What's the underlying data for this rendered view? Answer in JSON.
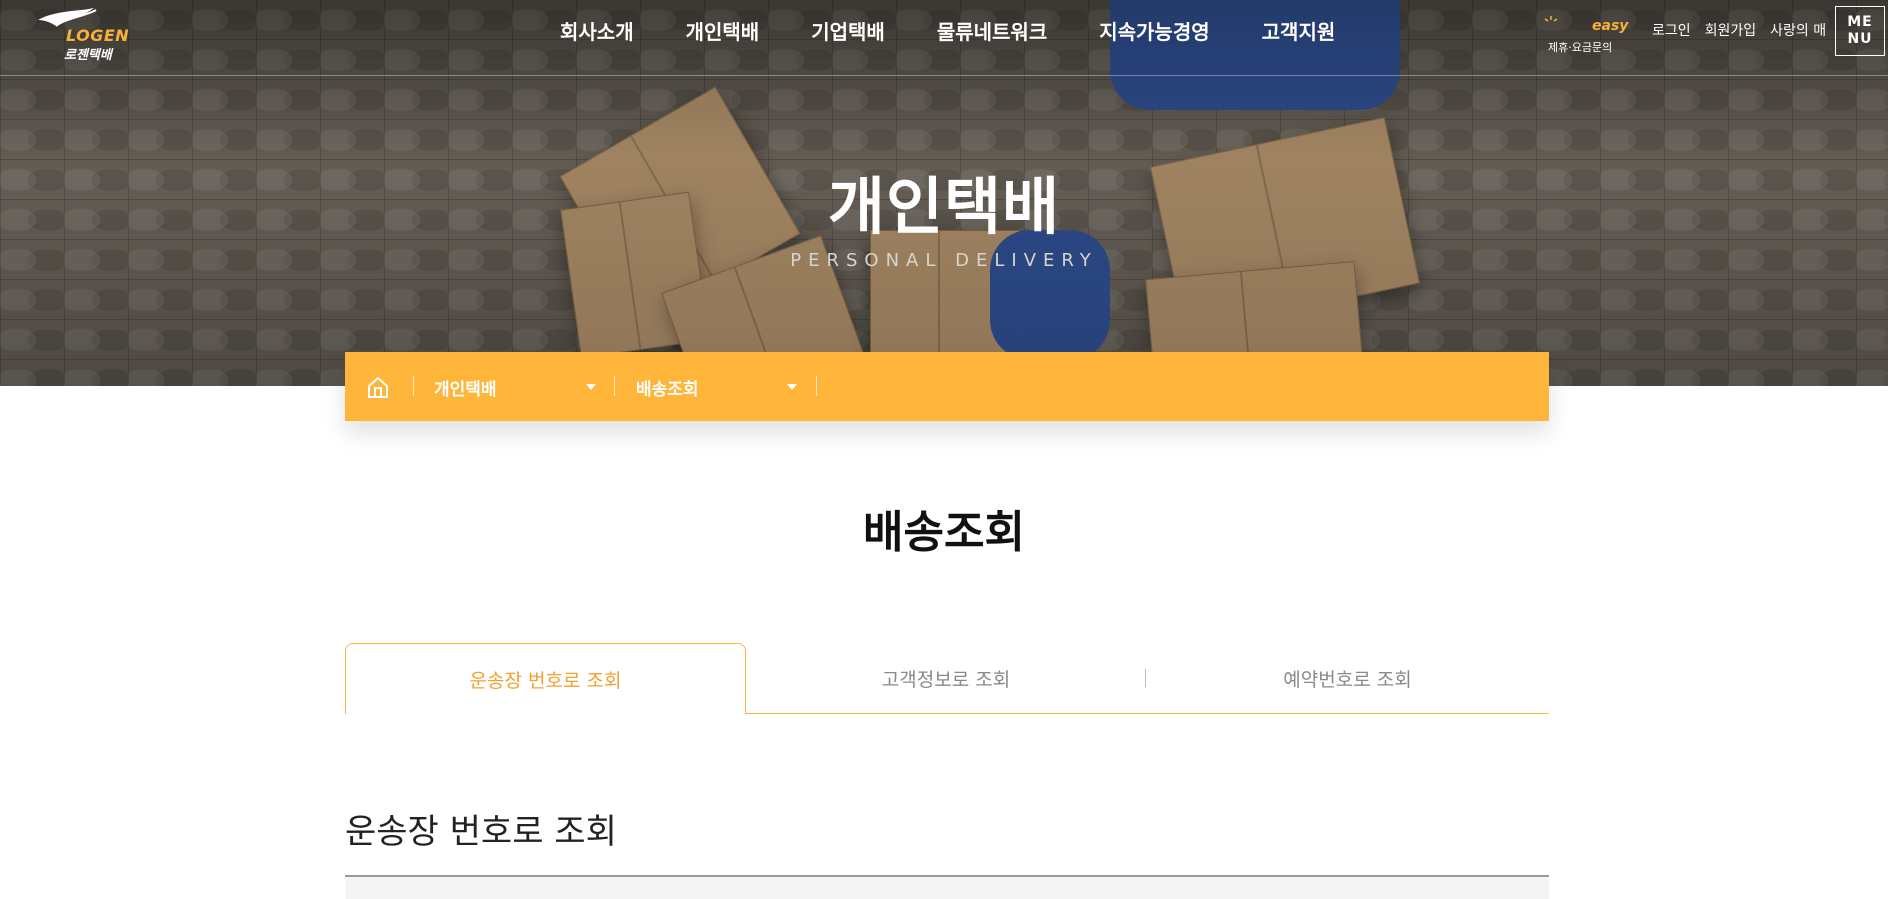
{
  "header": {
    "logo": {
      "word": "LOGEN",
      "sub": "로젠택배"
    },
    "nav": [
      "회사소개",
      "개인택배",
      "기업택배",
      "물류네트워크",
      "지속가능경영",
      "고객지원"
    ],
    "easy": {
      "word": "easy",
      "sub": "제휴·요금문의"
    },
    "util_links": [
      "로그인",
      "회원가입",
      "사랑의 매"
    ],
    "menu_label_line1": "ME",
    "menu_label_line2": "NU"
  },
  "hero": {
    "title": "개인택배",
    "subtitle": "PERSONAL DELIVERY"
  },
  "location": {
    "level1": "개인택배",
    "level2": "배송조회"
  },
  "page": {
    "title": "배송조회"
  },
  "tabs": [
    {
      "label": "운송장 번호로 조회",
      "active": true
    },
    {
      "label": "고객정보로 조회",
      "active": false
    },
    {
      "label": "예약번호로 조회",
      "active": false
    }
  ],
  "section": {
    "title": "운송장 번호로 조회"
  },
  "colors": {
    "accent": "#ffb43a",
    "accent_text": "#f5a02c",
    "brand_logo": "#f7b03a"
  },
  "icons": [
    "home-icon",
    "chevron-down-icon",
    "logo-bird-icon",
    "sparkle-icon"
  ]
}
